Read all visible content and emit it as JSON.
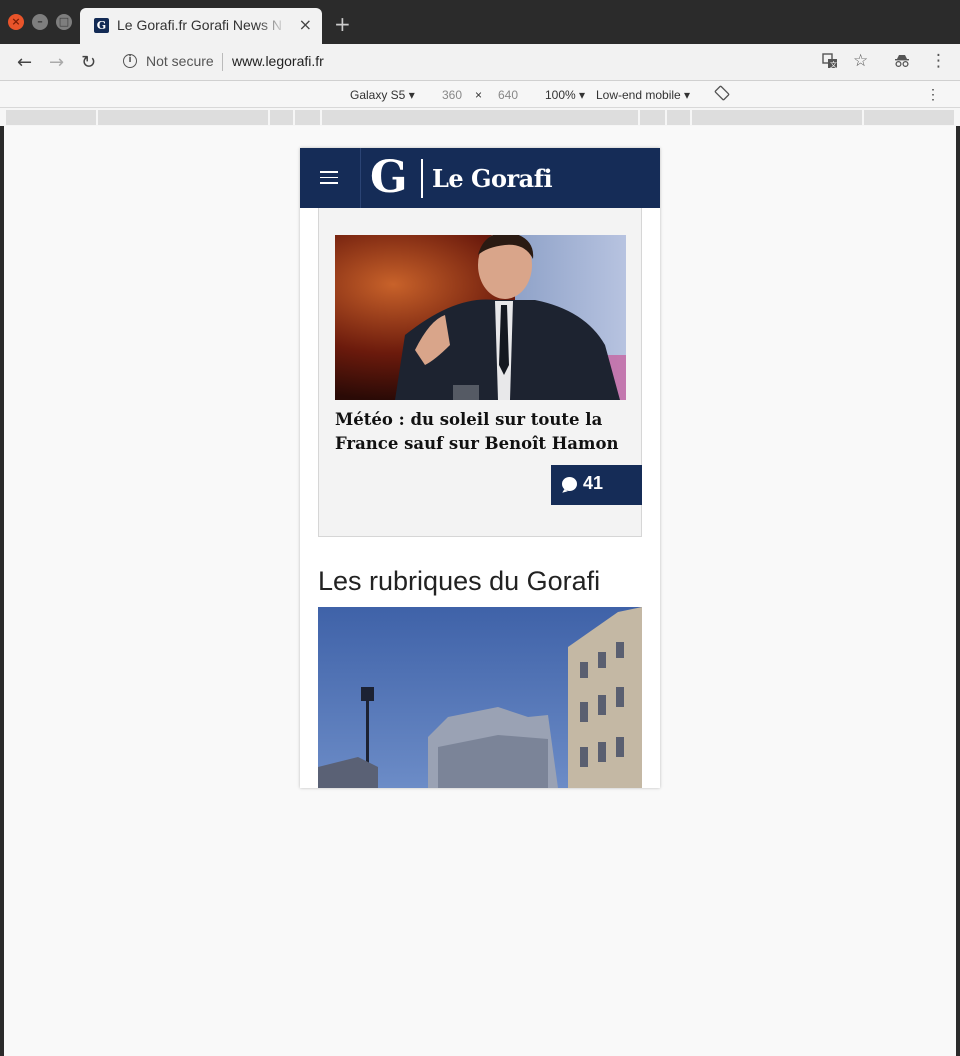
{
  "browser": {
    "tab_title": "Le Gorafi.fr Gorafi News N",
    "tab_favicon": "G",
    "new_tab": "+",
    "tab_close": "×",
    "security_label": "Not secure",
    "url": "www.legorafi.fr"
  },
  "device_toolbar": {
    "device": "Galaxy S5",
    "width": "360",
    "times": "×",
    "height": "640",
    "zoom": "100%",
    "throttle": "Low-end mobile"
  },
  "site": {
    "logo_mark": "G",
    "logo_text": "Le Gorafi",
    "article": {
      "title": "Météo : du soleil sur toute la France sauf sur Benoît Hamon",
      "comments": "41"
    },
    "section_title": "Les rubriques du Gorafi"
  },
  "colors": {
    "brand_navy": "#152c57",
    "chrome_dark": "#2b2b2b",
    "close_button": "#e9542a"
  }
}
